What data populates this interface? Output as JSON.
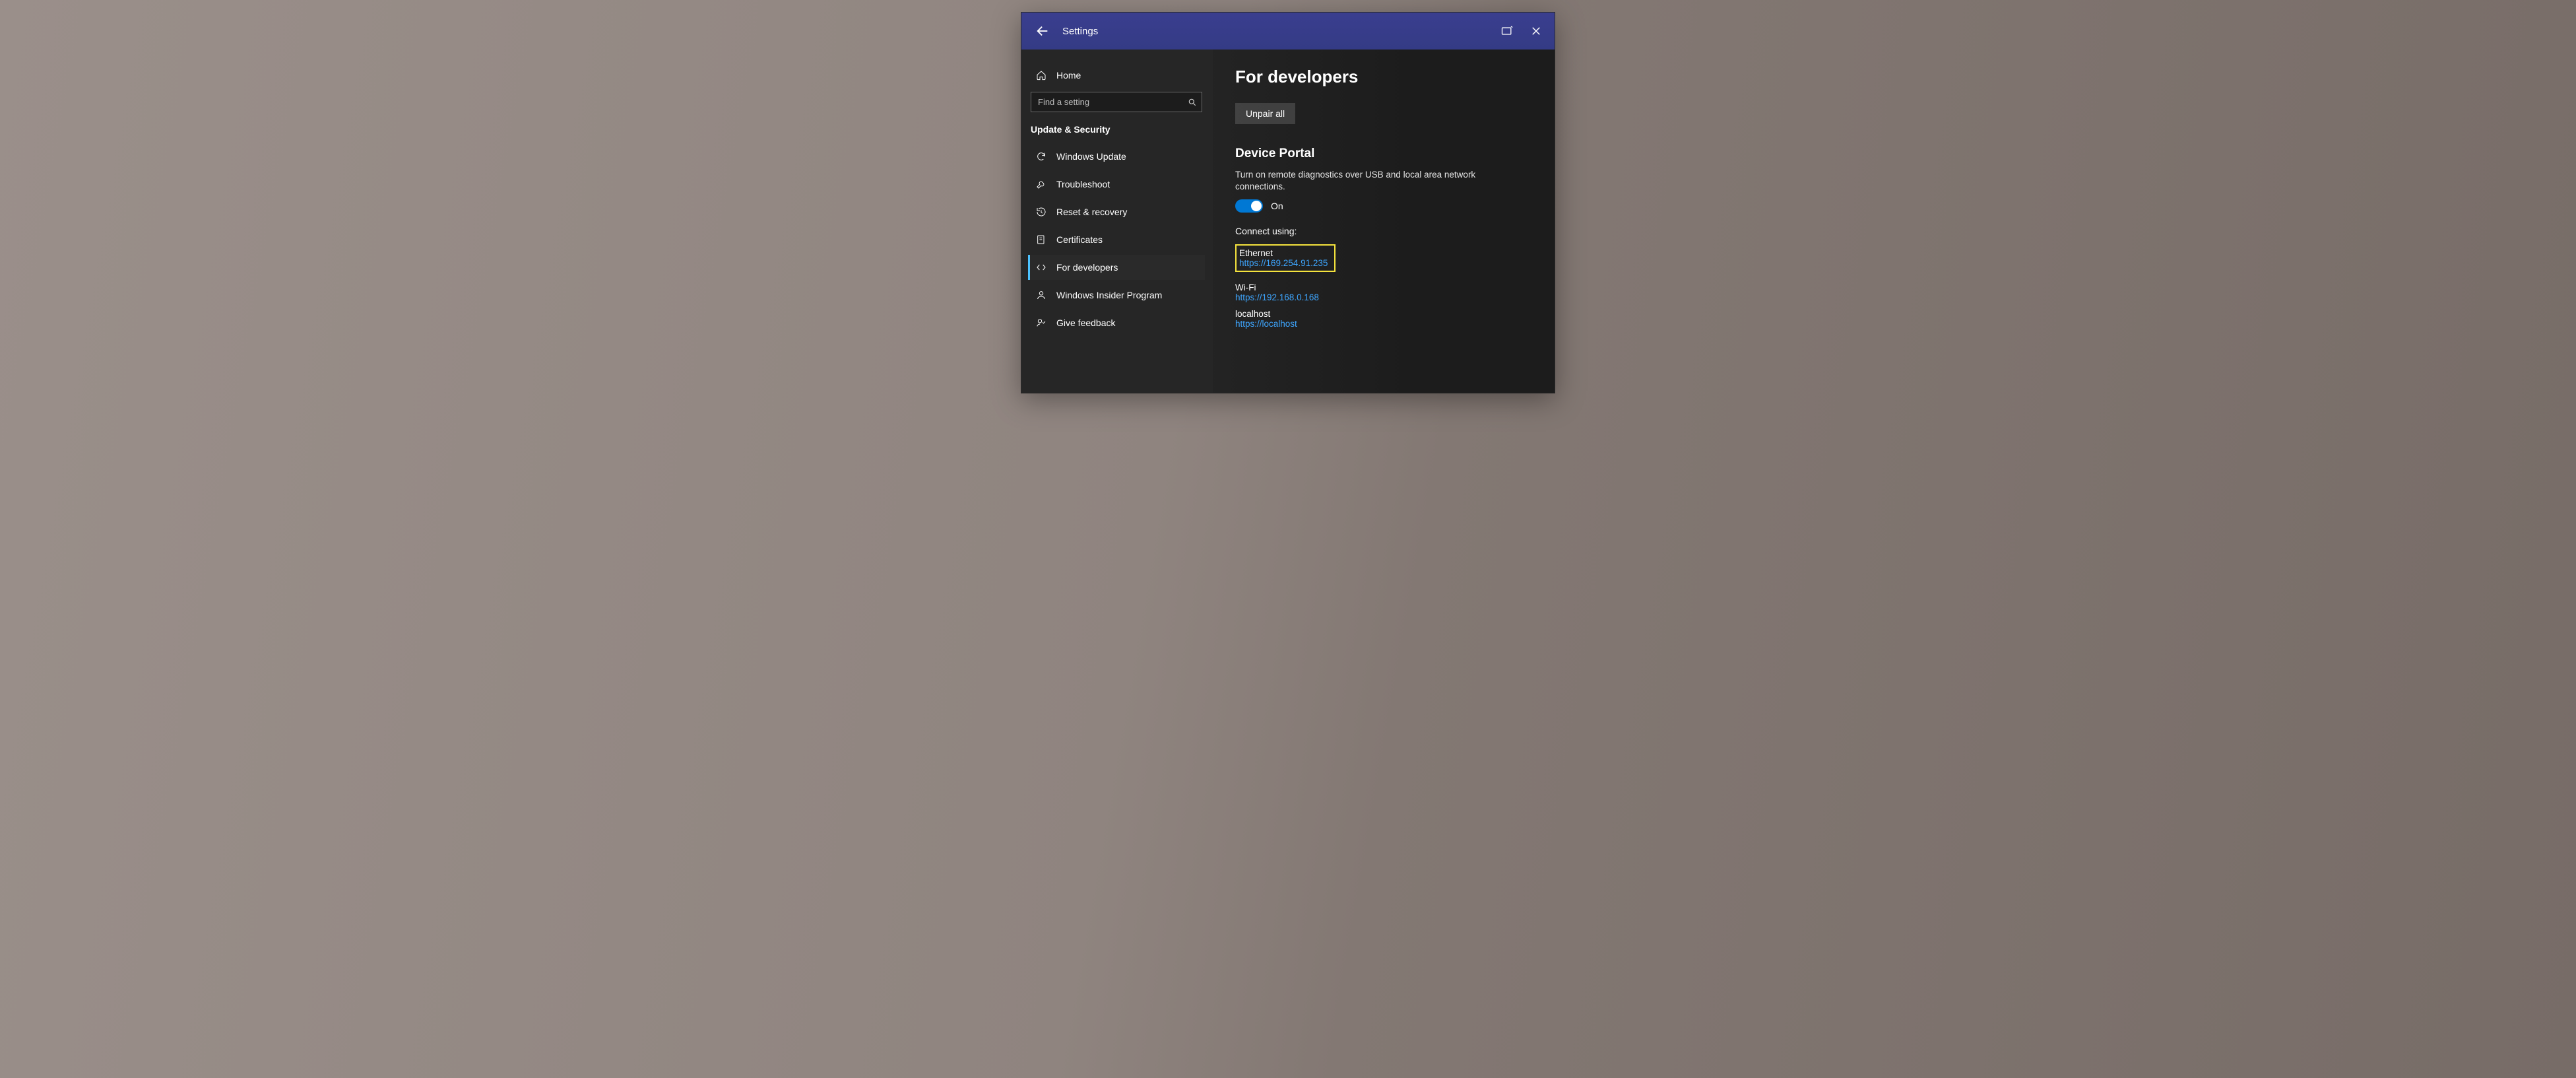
{
  "titlebar": {
    "title": "Settings"
  },
  "sidebar": {
    "home_label": "Home",
    "search_placeholder": "Find a setting",
    "category_label": "Update & Security",
    "items": [
      {
        "label": "Windows Update"
      },
      {
        "label": "Troubleshoot"
      },
      {
        "label": "Reset & recovery"
      },
      {
        "label": "Certificates"
      },
      {
        "label": "For developers"
      },
      {
        "label": "Windows Insider Program"
      },
      {
        "label": "Give feedback"
      }
    ]
  },
  "content": {
    "page_title": "For developers",
    "unpair_label": "Unpair all",
    "device_portal_heading": "Device Portal",
    "device_portal_desc": "Turn on remote diagnostics over USB and local area network connections.",
    "toggle_state_label": "On",
    "connect_label": "Connect using:",
    "connections": [
      {
        "name": "Ethernet",
        "url": "https://169.254.91.235",
        "highlighted": true
      },
      {
        "name": "Wi-Fi",
        "url": "https://192.168.0.168",
        "highlighted": false
      },
      {
        "name": "localhost",
        "url": "https://localhost",
        "highlighted": false
      }
    ]
  }
}
